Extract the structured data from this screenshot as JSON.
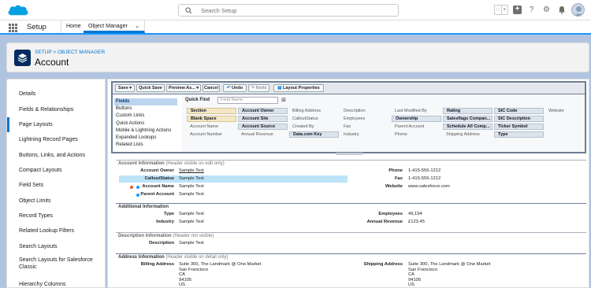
{
  "header": {
    "search_placeholder": "Search Setup",
    "icons": [
      "star-icon",
      "chevron-down-icon",
      "plus-icon",
      "help-icon",
      "gear-icon",
      "bell-icon",
      "avatar"
    ]
  },
  "nav": {
    "app_name": "Setup",
    "tabs": [
      {
        "label": "Home"
      },
      {
        "label": "Object Manager"
      }
    ]
  },
  "page_header": {
    "breadcrumb": "SETUP > OBJECT MANAGER",
    "title": "Account"
  },
  "sidebar": {
    "items": [
      {
        "label": "Details"
      },
      {
        "label": "Fields & Relationships"
      },
      {
        "label": "Page Layouts"
      },
      {
        "label": "Lightning Record Pages"
      },
      {
        "label": "Buttons, Links, and Actions"
      },
      {
        "label": "Compact Layouts"
      },
      {
        "label": "Field Sets"
      },
      {
        "label": "Object Limits"
      },
      {
        "label": "Record Types"
      },
      {
        "label": "Related Lookup Filters"
      },
      {
        "label": "Search Layouts"
      },
      {
        "label": "Search Layouts for Salesforce Classic"
      },
      {
        "label": "Hierarchy Columns"
      }
    ],
    "active": "Page Layouts"
  },
  "toolbar": {
    "save": "Save ▾",
    "quick_save": "Quick Save",
    "preview_as": "Preview As... ▾",
    "cancel": "Cancel",
    "undo": "Undo",
    "redo": "Redo",
    "layout_properties": "Layout Properties"
  },
  "palette": {
    "categories": [
      "Fields",
      "Buttons",
      "Custom Links",
      "Quick Actions",
      "Mobile & Lightning Actions",
      "Expanded Lookups",
      "Related Lists"
    ],
    "quick_find_label": "Quick Find",
    "quick_find_placeholder": "Field Name",
    "fields": [
      [
        "Section",
        "Account Owner",
        "Billing Address",
        "Description",
        "Last Modified By",
        "Rating",
        "SIC Code",
        "Website"
      ],
      [
        "Blank Space",
        "Account Site",
        "CalloutStatus",
        "Employees",
        "Ownership",
        "Salesflags Compan...",
        "SIC Description",
        ""
      ],
      [
        "Account Name",
        "Account Source",
        "Created By",
        "Fax",
        "Parent Account",
        "Schedule All Comp...",
        "Ticker Symbol",
        ""
      ],
      [
        "Account Number",
        "Annual Revenue",
        "Data.com Key",
        "Industry",
        "Phone",
        "Shipping Address",
        "Type",
        ""
      ]
    ]
  },
  "layout": {
    "sections": {
      "account_info": {
        "title": "Account Information",
        "hint": "(Header visible on edit only)"
      },
      "additional_info": {
        "title": "Additional Information"
      },
      "description_info": {
        "title": "Description Information",
        "hint": "(Header not visible)"
      },
      "address_info": {
        "title": "Address Information",
        "hint": "(Header visible on detail only)"
      }
    },
    "account_info_left": [
      {
        "label": "Account Owner",
        "value": "Sample Text"
      },
      {
        "label": "CalloutStatus",
        "value": "Sample Text"
      },
      {
        "label": "Account Name",
        "value": "Sample Text"
      },
      {
        "label": "Parent Account",
        "value": "Sample Text"
      }
    ],
    "account_info_right": [
      {
        "label": "Phone",
        "value": "1-415-555-1212"
      },
      {
        "label": "Fax",
        "value": "1-415-555-1212"
      },
      {
        "label": "Website",
        "value": "www.salesforce.com"
      }
    ],
    "additional_left": [
      {
        "label": "Type",
        "value": "Sample Text"
      },
      {
        "label": "Industry",
        "value": "Sample Text"
      }
    ],
    "additional_right": [
      {
        "label": "Employees",
        "value": "49,194"
      },
      {
        "label": "Annual Revenue",
        "value": "£123.45"
      }
    ],
    "description": {
      "label": "Description",
      "value": "Sample Text"
    },
    "billing": {
      "label": "Billing Address",
      "lines": [
        "Suite 300, The Landmark @ One Market",
        "San Francisco",
        "CA",
        "94105",
        "US"
      ]
    },
    "shipping": {
      "label": "Shipping Address",
      "lines": [
        "Suite 300, The Landmark @ One Market",
        "San Francisco",
        "CA",
        "94105",
        "US"
      ]
    }
  },
  "colors": {
    "brand": "#0176d3",
    "header_dark": "#032d60",
    "background": "#b0c4df"
  }
}
